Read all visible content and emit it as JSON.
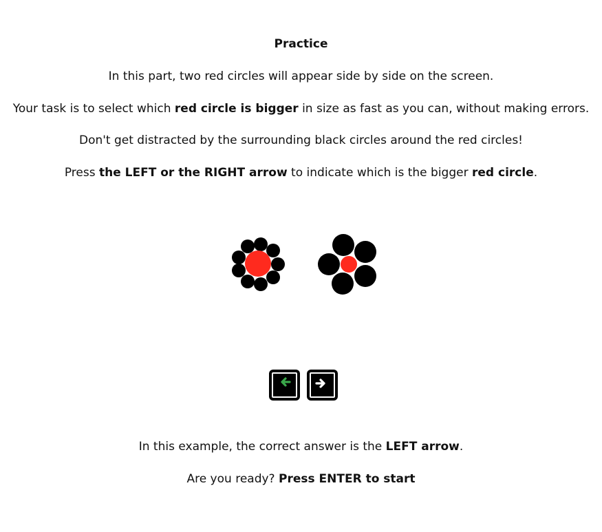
{
  "title": "Practice",
  "intro": "In this part, two red circles will appear side by side on the screen.",
  "task": {
    "before": "Your task is to select which ",
    "bold": "red circle is bigger",
    "after": " in size as fast as you can, without making errors."
  },
  "distract": "Don't get distracted by the surrounding black circles around the red circles!",
  "instruction": {
    "before": "Press ",
    "bold1": "the LEFT or the RIGHT arrow",
    "middle": " to indicate which is the bigger ",
    "bold2": "red circle",
    "after": "."
  },
  "example": {
    "before": "In this example, the correct answer is the ",
    "bold": "LEFT arrow",
    "after": "."
  },
  "ready": {
    "before": "Are you ready? ",
    "bold": "Press ENTER to start"
  },
  "keys": {
    "left_icon": "left-arrow-icon",
    "right_icon": "right-arrow-icon"
  },
  "colors": {
    "target_circle": "#ff2a1e",
    "inducer_circle": "#000000",
    "left_key_arrow": "#3aa84a",
    "right_key_arrow": "#ffffff"
  }
}
